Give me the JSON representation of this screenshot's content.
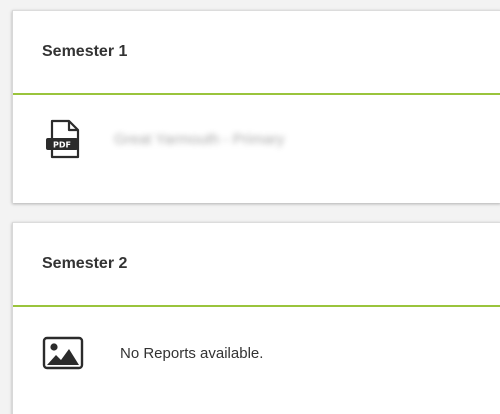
{
  "semesters": [
    {
      "title": "Semester 1",
      "report_link": "Great Yarmouth - Primary",
      "icon": "pdf-file-icon"
    },
    {
      "title": "Semester 2",
      "empty_message": "No Reports available.",
      "icon": "image-icon"
    }
  ],
  "colors": {
    "accent": "#9ac43c",
    "text": "#333333",
    "background": "#f3f3f3"
  }
}
